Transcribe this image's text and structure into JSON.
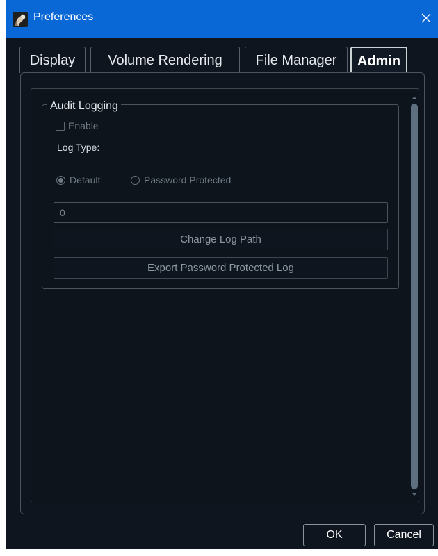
{
  "window": {
    "title": "Preferences",
    "titlebar_color": "#0a67d6",
    "background": "#0e151e"
  },
  "tabs": [
    {
      "label": "Display",
      "active": false
    },
    {
      "label": "Volume Rendering",
      "active": false
    },
    {
      "label": "File Manager",
      "active": false
    },
    {
      "label": "Admin",
      "active": true
    }
  ],
  "audit_logging": {
    "title": "Audit Logging",
    "enable_label": "Enable",
    "enable_checked": false,
    "log_type_label": "Log Type:",
    "radio_default_label": "Default",
    "radio_default_checked": true,
    "radio_password_label": "Password Protected",
    "radio_password_checked": false,
    "path_value": "0",
    "change_path_label": "Change Log Path",
    "export_label": "Export Password Protected Log"
  },
  "footer": {
    "ok_label": "OK",
    "cancel_label": "Cancel"
  },
  "icons": {
    "app": "app-icon",
    "close": "close-icon"
  }
}
